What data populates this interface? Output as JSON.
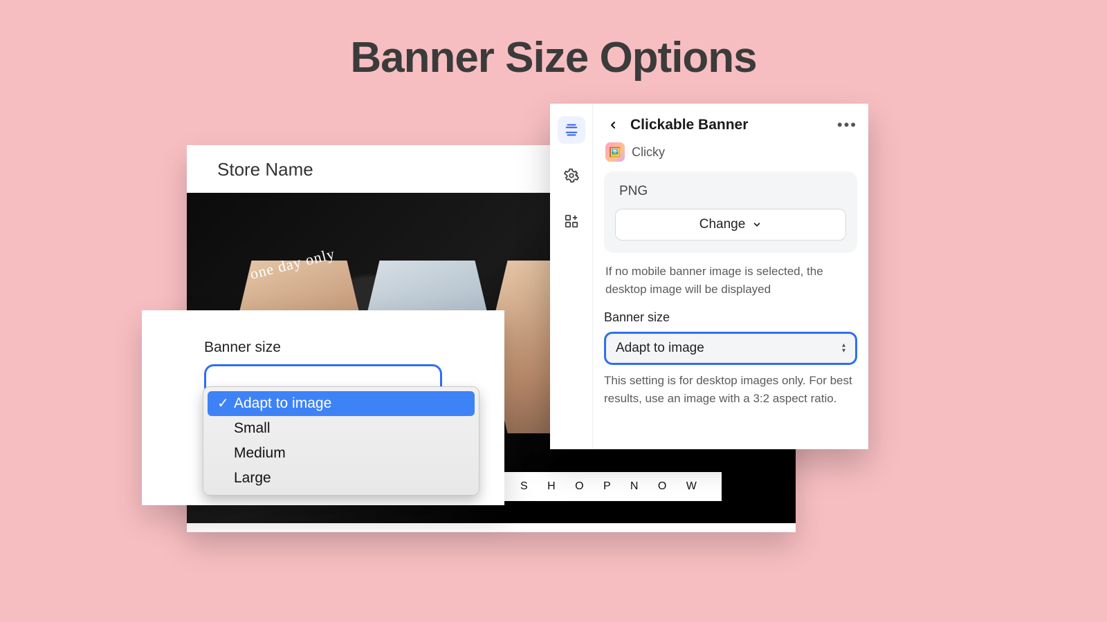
{
  "title": "Banner Size Options",
  "store": {
    "name": "Store Name",
    "badge": "one day only",
    "cta": "S H O P   N O W"
  },
  "left": {
    "label": "Banner size",
    "options": [
      "Adapt to image",
      "Small",
      "Medium",
      "Large"
    ]
  },
  "panel": {
    "title": "Clickable Banner",
    "app": "Clicky",
    "upload_format": "PNG",
    "change_label": "Change",
    "hint1": "If no mobile banner image is selected, the desktop image will be displayed",
    "field_label": "Banner size",
    "select_value": "Adapt to image",
    "hint2": "This setting is for desktop images only. For best results, use an image with a 3:2 aspect ratio."
  }
}
